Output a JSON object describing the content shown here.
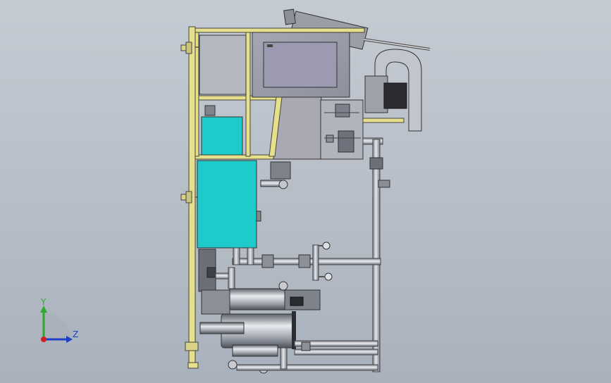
{
  "triad": {
    "y_label": "Y",
    "z_label": "Z"
  },
  "colors": {
    "background": "#b8bfc9",
    "frame": "#e6e08a",
    "frame_edge": "#444444",
    "tank": "#1ecbcb",
    "steel": "#a9aeb8",
    "panel": "#9a9ca8",
    "triad_y": "#2ea82e",
    "triad_z": "#1d3fc4",
    "triad_x": "#d21f1f"
  }
}
